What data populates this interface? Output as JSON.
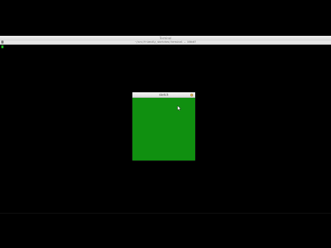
{
  "terminal": {
    "title": "Terminal",
    "path": "~/src/friendly_sketches/terminal — 160×67",
    "cursor_color": "#1fb31f"
  },
  "sketch": {
    "title": "sketch",
    "canvas_color": "#109010"
  },
  "icons": {
    "terminal_icon": "folder-icon",
    "zoom": "zoom-button-icon",
    "pointer": "mouse-pointer-icon"
  }
}
